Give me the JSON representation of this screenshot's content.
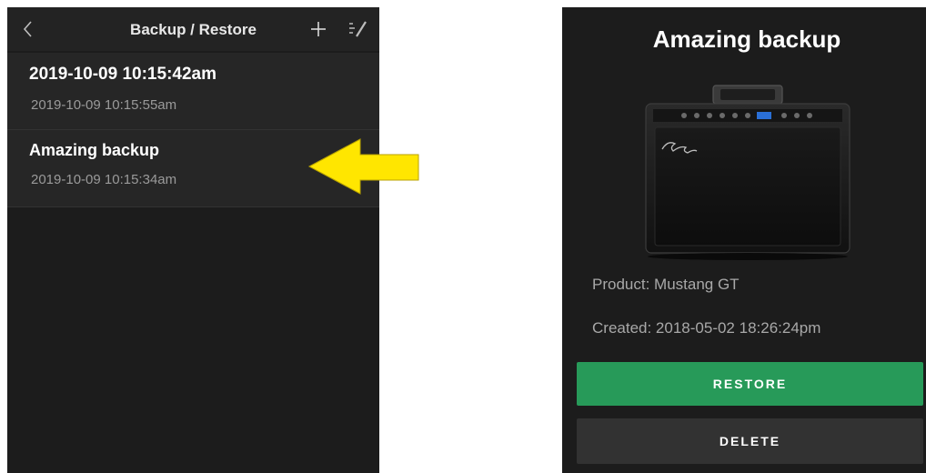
{
  "list_screen": {
    "nav": {
      "back_icon": "chevron-left-icon",
      "title": "Backup / Restore",
      "add_icon": "plus-icon",
      "edit_icon": "edit-list-icon"
    },
    "items": [
      {
        "title": "2019-10-09 10:15:42am",
        "date": "2019-10-09 10:15:55am"
      },
      {
        "title": "Amazing backup",
        "date": "2019-10-09 10:15:34am"
      }
    ]
  },
  "annotation": {
    "arrow_icon": "yellow-arrow-left-icon",
    "color": "#ffe600"
  },
  "detail_screen": {
    "title": "Amazing backup",
    "image": "amplifier-image",
    "product": "Product: Mustang GT",
    "created": "Created: 2018-05-02 18:26:24pm",
    "restore_label": "RESTORE",
    "delete_label": "DELETE"
  },
  "colors": {
    "background": "#1c1c1c",
    "restore_button": "#279a59",
    "delete_button": "#323232",
    "secondary_text": "#9a9a9a"
  }
}
